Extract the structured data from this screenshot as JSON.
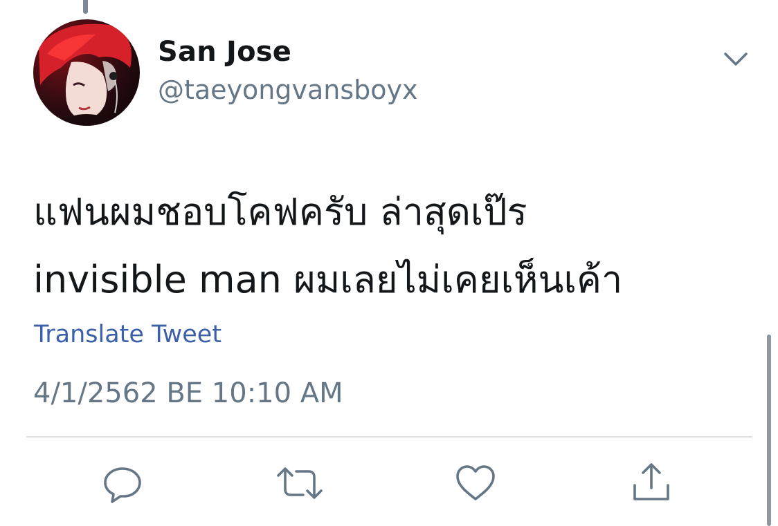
{
  "tweet": {
    "author": {
      "display_name": "San Jose",
      "handle": "@taeyongvansboyx",
      "avatar": "profile-photo"
    },
    "text_lines": [
      "แฟนผมชอบโคฟครับ ล่าสุดเป๊ร",
      "invisible man ผมเลยไม่เคยเห็นเค้า"
    ],
    "translate_label": "Translate Tweet",
    "timestamp": "4/1/2562 BE 10:10 AM",
    "menu_icon": "chevron-down-icon"
  },
  "actions": [
    {
      "name": "reply",
      "icon": "reply-icon"
    },
    {
      "name": "retweet",
      "icon": "retweet-icon"
    },
    {
      "name": "like",
      "icon": "heart-icon"
    },
    {
      "name": "share",
      "icon": "share-icon"
    }
  ],
  "colors": {
    "text_primary": "#14171a",
    "text_secondary": "#657786",
    "link": "#3b5fa8",
    "divider": "#dfe3e8",
    "icon": "#657786"
  }
}
